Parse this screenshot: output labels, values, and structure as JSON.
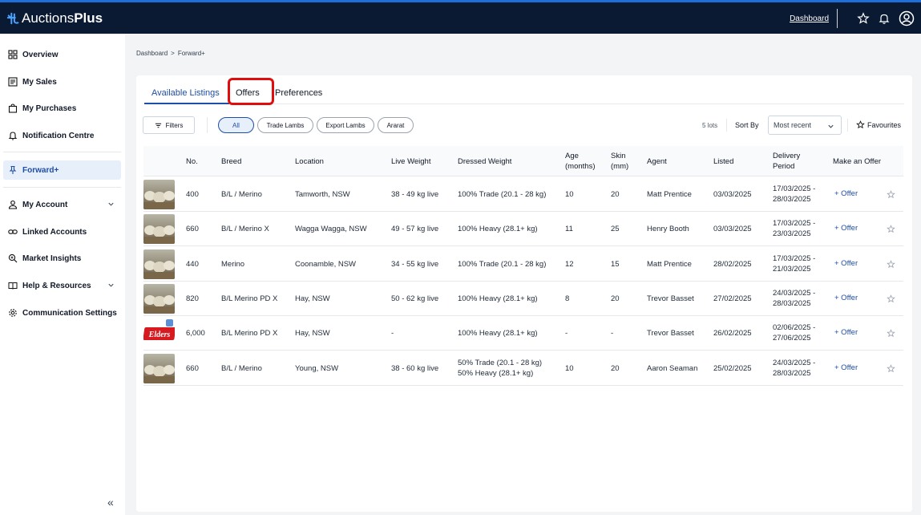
{
  "header": {
    "logo_part1": "Auctions",
    "logo_part2": "Plus",
    "dashboard_link": "Dashboard",
    "icons": [
      "star-icon",
      "bell-icon",
      "user-circle-icon"
    ]
  },
  "sidebar": {
    "items": [
      {
        "label": "Overview",
        "icon": "grid-icon"
      },
      {
        "label": "My Sales",
        "icon": "list-icon"
      },
      {
        "label": "My Purchases",
        "icon": "bag-icon"
      },
      {
        "label": "Notification Centre",
        "icon": "bell-icon"
      },
      {
        "label": "Forward+",
        "icon": "pin-icon"
      },
      {
        "label": "My Account",
        "icon": "user-icon"
      },
      {
        "label": "Linked Accounts",
        "icon": "link-icon"
      },
      {
        "label": "Market Insights",
        "icon": "magnifier-icon"
      },
      {
        "label": "Help & Resources",
        "icon": "book-icon"
      },
      {
        "label": "Communication Settings",
        "icon": "gear-icon"
      }
    ],
    "collapse_label": "«"
  },
  "breadcrumb": {
    "home": "Dashboard",
    "separator": ">",
    "current": "Forward+"
  },
  "tabs": [
    {
      "label": "Available Listings"
    },
    {
      "label": "Offers"
    },
    {
      "label": "Preferences"
    }
  ],
  "toolbar": {
    "filters_label": "Filters",
    "chips": [
      "All",
      "Trade Lambs",
      "Export Lambs",
      "Ararat"
    ],
    "lots_count": "5 lots",
    "sort_by_label": "Sort By",
    "sort_value": "Most recent",
    "favourites_label": "Favourites"
  },
  "table": {
    "headers": {
      "no": "No.",
      "breed": "Breed",
      "location": "Location",
      "live_weight": "Live Weight",
      "dressed_weight": "Dressed Weight",
      "age_1": "Age",
      "age_2": "(months)",
      "skin_1": "Skin",
      "skin_2": "(mm)",
      "agent": "Agent",
      "listed": "Listed",
      "delivery_1": "Delivery",
      "delivery_2": "Period",
      "offer": "Make an Offer"
    },
    "offer_label": "+ Offer",
    "rows": [
      {
        "no": "400",
        "breed": "B/L / Merino",
        "location": "Tamworth, NSW",
        "live": "38 - 49 kg live",
        "dressed_1": "100% Trade (20.1 - 28 kg)",
        "dressed_2": "",
        "age": "10",
        "skin": "20",
        "agent": "Matt Prentice",
        "listed": "03/03/2025",
        "delivery_1": "17/03/2025 -",
        "delivery_2": "28/03/2025"
      },
      {
        "no": "660",
        "breed": "B/L / Merino X",
        "location": "Wagga Wagga, NSW",
        "live": "49 - 57 kg live",
        "dressed_1": "100% Heavy (28.1+ kg)",
        "dressed_2": "",
        "age": "11",
        "skin": "25",
        "agent": "Henry Booth",
        "listed": "03/03/2025",
        "delivery_1": "17/03/2025 -",
        "delivery_2": "23/03/2025"
      },
      {
        "no": "440",
        "breed": "Merino",
        "location": "Coonamble, NSW",
        "live": "34 - 55 kg live",
        "dressed_1": "100% Trade (20.1 - 28 kg)",
        "dressed_2": "",
        "age": "12",
        "skin": "15",
        "agent": "Matt Prentice",
        "listed": "28/02/2025",
        "delivery_1": "17/03/2025 -",
        "delivery_2": "21/03/2025"
      },
      {
        "no": "820",
        "breed": "B/L Merino PD X",
        "location": "Hay, NSW",
        "live": "50 - 62 kg live",
        "dressed_1": "100% Heavy (28.1+ kg)",
        "dressed_2": "",
        "age": "8",
        "skin": "20",
        "agent": "Trevor Basset",
        "listed": "27/02/2025",
        "delivery_1": "24/03/2025 -",
        "delivery_2": "28/03/2025"
      },
      {
        "no": "6,000",
        "breed": "B/L Merino PD X",
        "location": "Hay, NSW",
        "live": "-",
        "dressed_1": "100% Heavy (28.1+ kg)",
        "dressed_2": "",
        "age": "-",
        "skin": "-",
        "agent": "Trevor Basset",
        "listed": "26/02/2025",
        "delivery_1": "02/06/2025 -",
        "delivery_2": "27/06/2025",
        "thumb_text": "Elders"
      },
      {
        "no": "660",
        "breed": "B/L / Merino",
        "location": "Young, NSW",
        "live": "38 - 60 kg live",
        "dressed_1": "50% Trade (20.1 - 28 kg)",
        "dressed_2": "50% Heavy (28.1+ kg)",
        "age": "10",
        "skin": "20",
        "agent": "Aaron Seaman",
        "listed": "25/02/2025",
        "delivery_1": "24/03/2025 -",
        "delivery_2": "28/03/2025"
      }
    ]
  },
  "colors": {
    "topbar": "#0b1a33",
    "accent": "#1d4ea8",
    "highlight": "#e10c0c",
    "elders_red": "#d71920"
  }
}
